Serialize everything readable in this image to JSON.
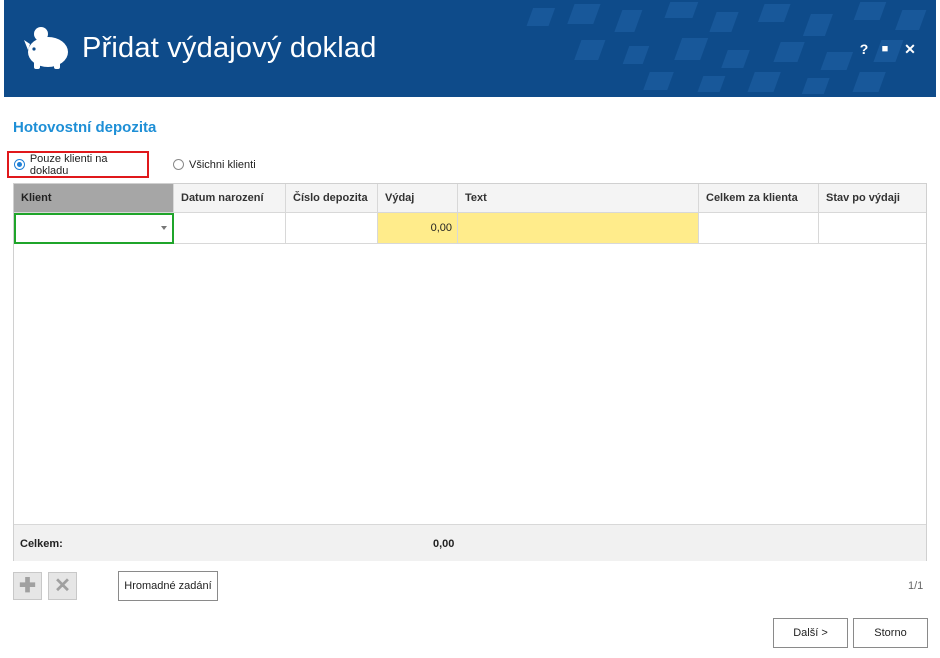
{
  "window": {
    "title": "Přidat výdajový doklad",
    "help_label": "?",
    "maximize_label": "■",
    "close_label": "✕",
    "titlebar_color": "#0e4b8a"
  },
  "section": {
    "title": "Hotovostní depozita"
  },
  "filter": {
    "options": [
      "Pouze klienti na dokladu",
      "Všichni klienti"
    ],
    "selected": "Pouze klienti na dokladu"
  },
  "grid": {
    "columns": [
      "Klient",
      "Datum narození",
      "Číslo depozita",
      "Výdaj",
      "Text",
      "Celkem za klienta",
      "Stav po výdaji"
    ],
    "rows": [
      {
        "klient": "",
        "datum": "",
        "cislo": "",
        "vydaj": "0,00",
        "text": "",
        "celkem": "",
        "stav": ""
      }
    ],
    "footer": {
      "label": "Celkem:",
      "total": "0,00"
    }
  },
  "toolbar": {
    "add_icon": "plus-icon",
    "delete_icon": "x-icon",
    "bulk_label": "Hromadné zadání",
    "pager": "1/1"
  },
  "actions": {
    "next_label": "Další >",
    "cancel_label": "Storno"
  },
  "colors": {
    "accent": "#1e8fd6",
    "highlight": "#ffec8b",
    "selection_border": "#e0181b",
    "focus_border": "#1fa52a"
  }
}
